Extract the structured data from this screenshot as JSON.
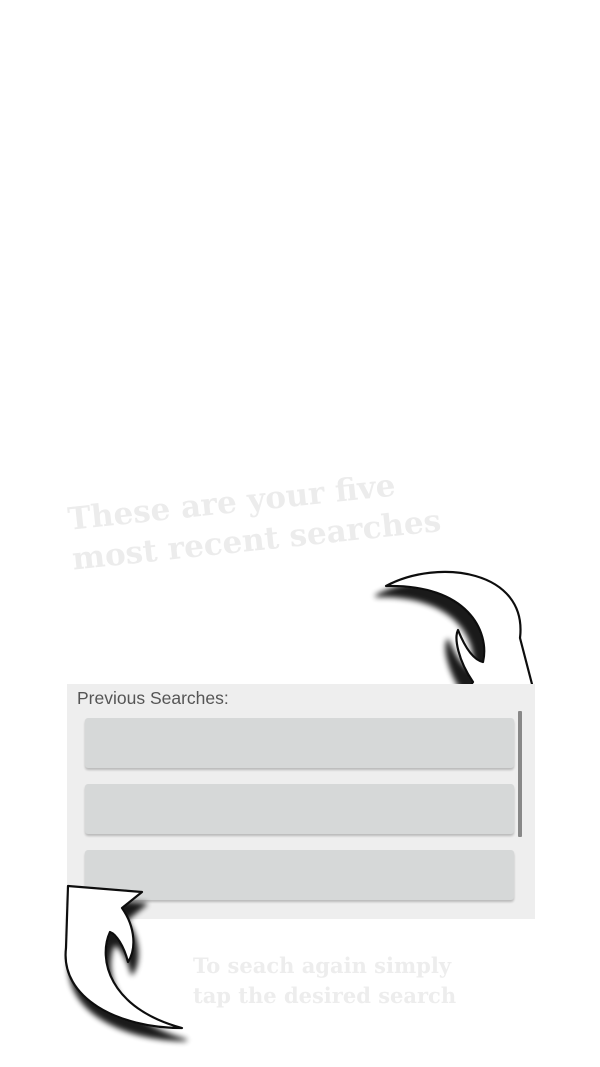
{
  "hints": {
    "top": {
      "line1": "These are your five",
      "line2": "most recent searches"
    },
    "bottom": {
      "line1": "To seach again simply",
      "line2": "tap the desired search"
    }
  },
  "panel": {
    "title": "Previous Searches:",
    "items": [
      "",
      "",
      ""
    ]
  },
  "icons": {
    "top_arrow": "curved-arrow-icon",
    "bottom_arrow": "curved-arrow-icon"
  },
  "colors": {
    "panel_background": "#eeeeee",
    "item_background": "#d6d8d8",
    "hint_text": "#ececec"
  }
}
